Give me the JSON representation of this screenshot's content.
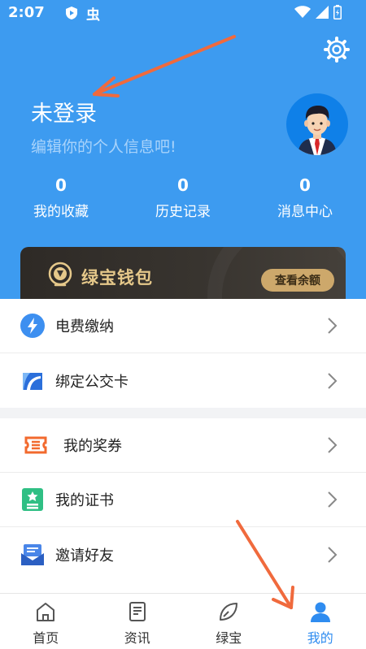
{
  "status_bar": {
    "time": "2:07",
    "app_glyph": "虫"
  },
  "header": {
    "login_title": "未登录",
    "login_subtitle": "编辑你的个人信息吧!",
    "stats": [
      {
        "value": "0",
        "label": "我的收藏"
      },
      {
        "value": "0",
        "label": "历史记录"
      },
      {
        "value": "0",
        "label": "消息中心"
      }
    ]
  },
  "wallet": {
    "title": "绿宝钱包",
    "button_label": "查看余额"
  },
  "menu_group_1": [
    {
      "label": "电费缴纳",
      "icon": "lightning-icon"
    },
    {
      "label": "绑定公交卡",
      "icon": "transit-card-icon"
    }
  ],
  "menu_group_2": [
    {
      "label": "我的奖券",
      "icon": "coupon-icon"
    },
    {
      "label": "我的证书",
      "icon": "certificate-icon"
    },
    {
      "label": "邀请好友",
      "icon": "invite-icon"
    }
  ],
  "tabbar": {
    "items": [
      {
        "label": "首页",
        "icon": "home-icon",
        "active": false
      },
      {
        "label": "资讯",
        "icon": "news-icon",
        "active": false
      },
      {
        "label": "绿宝",
        "icon": "leaf-icon",
        "active": false
      },
      {
        "label": "我的",
        "icon": "person-icon",
        "active": true
      }
    ]
  },
  "colors": {
    "header_bg": "#3d9bf0",
    "wallet_gold": "#e5c88a",
    "tab_active": "#2f8cf0",
    "annotation_arrow": "#f06a3d"
  }
}
